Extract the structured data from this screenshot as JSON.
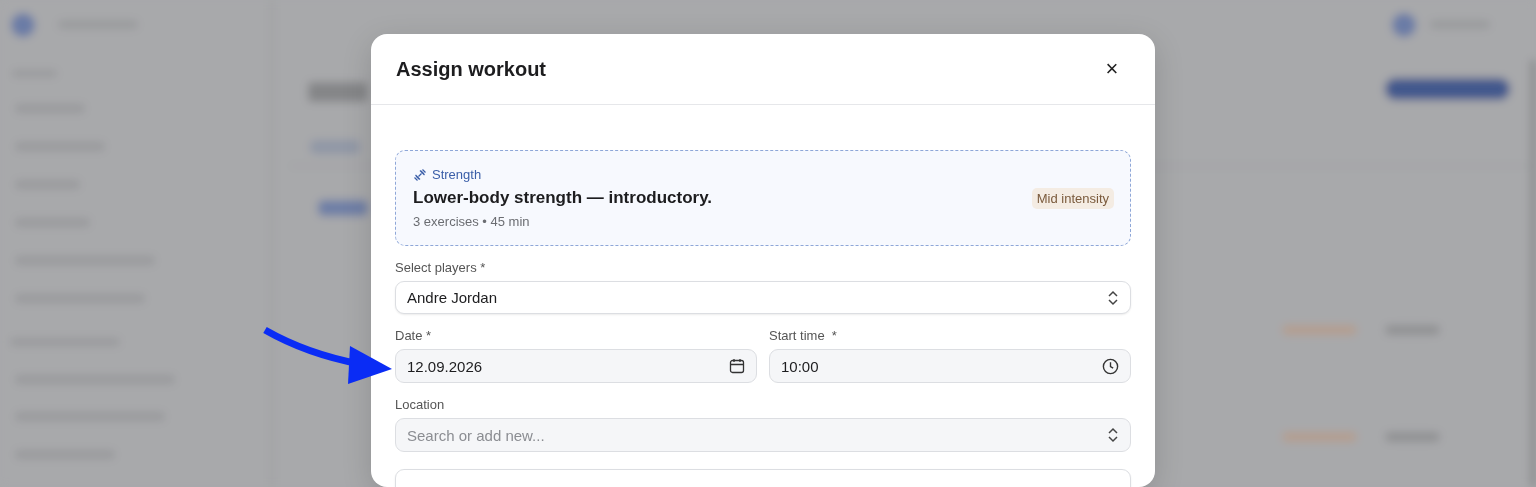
{
  "dialog": {
    "title": "Assign workout",
    "close": "×"
  },
  "workout": {
    "category": "Strength",
    "title": "Lower-body strength — introductory.",
    "meta": "3 exercises • 45 min",
    "intensity": "Mid intensity"
  },
  "fields": [
    {
      "kind": "select",
      "label": "Select players *",
      "value": "Andre Jordan"
    },
    {
      "kind": "row",
      "fields": [
        {
          "kind": "date",
          "label": "Date *",
          "value": "12.09.2026"
        },
        {
          "kind": "time",
          "label": "Start time  *",
          "value": "10:00"
        }
      ]
    },
    {
      "kind": "select",
      "label": "Location",
      "placeholder": "Search or add new..."
    },
    {
      "kind": "text"
    }
  ]
}
